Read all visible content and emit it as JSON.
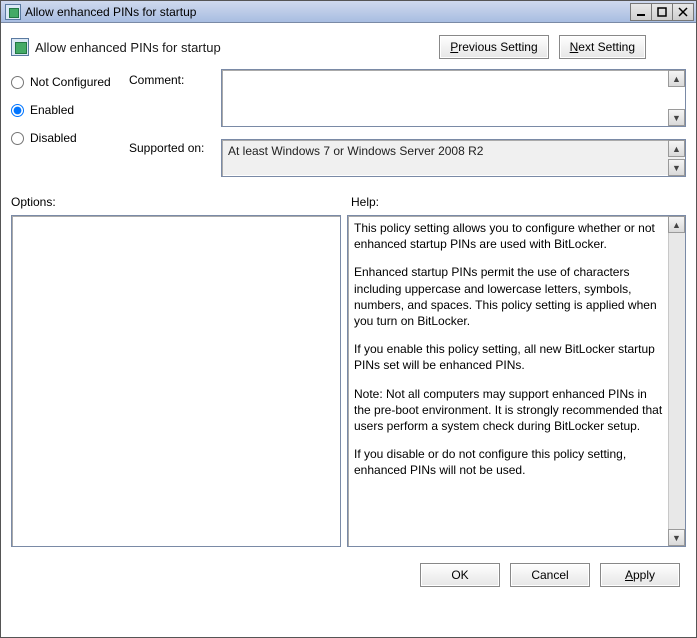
{
  "window": {
    "title": "Allow enhanced PINs for startup",
    "buttons": {
      "minimize": "–",
      "maximize": "❐",
      "close": "✕"
    }
  },
  "header": {
    "title": "Allow enhanced PINs for startup",
    "prev": "Previous Setting",
    "next": "Next Setting"
  },
  "config": {
    "not_configured": "Not Configured",
    "enabled": "Enabled",
    "disabled": "Disabled",
    "selected": "enabled"
  },
  "labels": {
    "comment": "Comment:",
    "supported_on": "Supported on:",
    "options": "Options:",
    "help": "Help:"
  },
  "supported_text": "At least Windows 7 or Windows Server 2008 R2",
  "help_paragraphs": [
    "This policy setting allows you to configure whether or not enhanced startup PINs are used with BitLocker.",
    "Enhanced startup PINs permit the use of characters including uppercase and lowercase letters, symbols, numbers, and spaces. This policy setting is applied when you turn on BitLocker.",
    "If you enable this policy setting, all new BitLocker startup PINs set will be enhanced PINs.",
    "Note:   Not all computers may support enhanced PINs in the pre-boot environment. It is strongly recommended that users perform a system check during BitLocker setup.",
    "If you disable or do not configure this policy setting, enhanced PINs will not be used."
  ],
  "footer": {
    "ok": "OK",
    "cancel": "Cancel",
    "apply": "Apply"
  }
}
